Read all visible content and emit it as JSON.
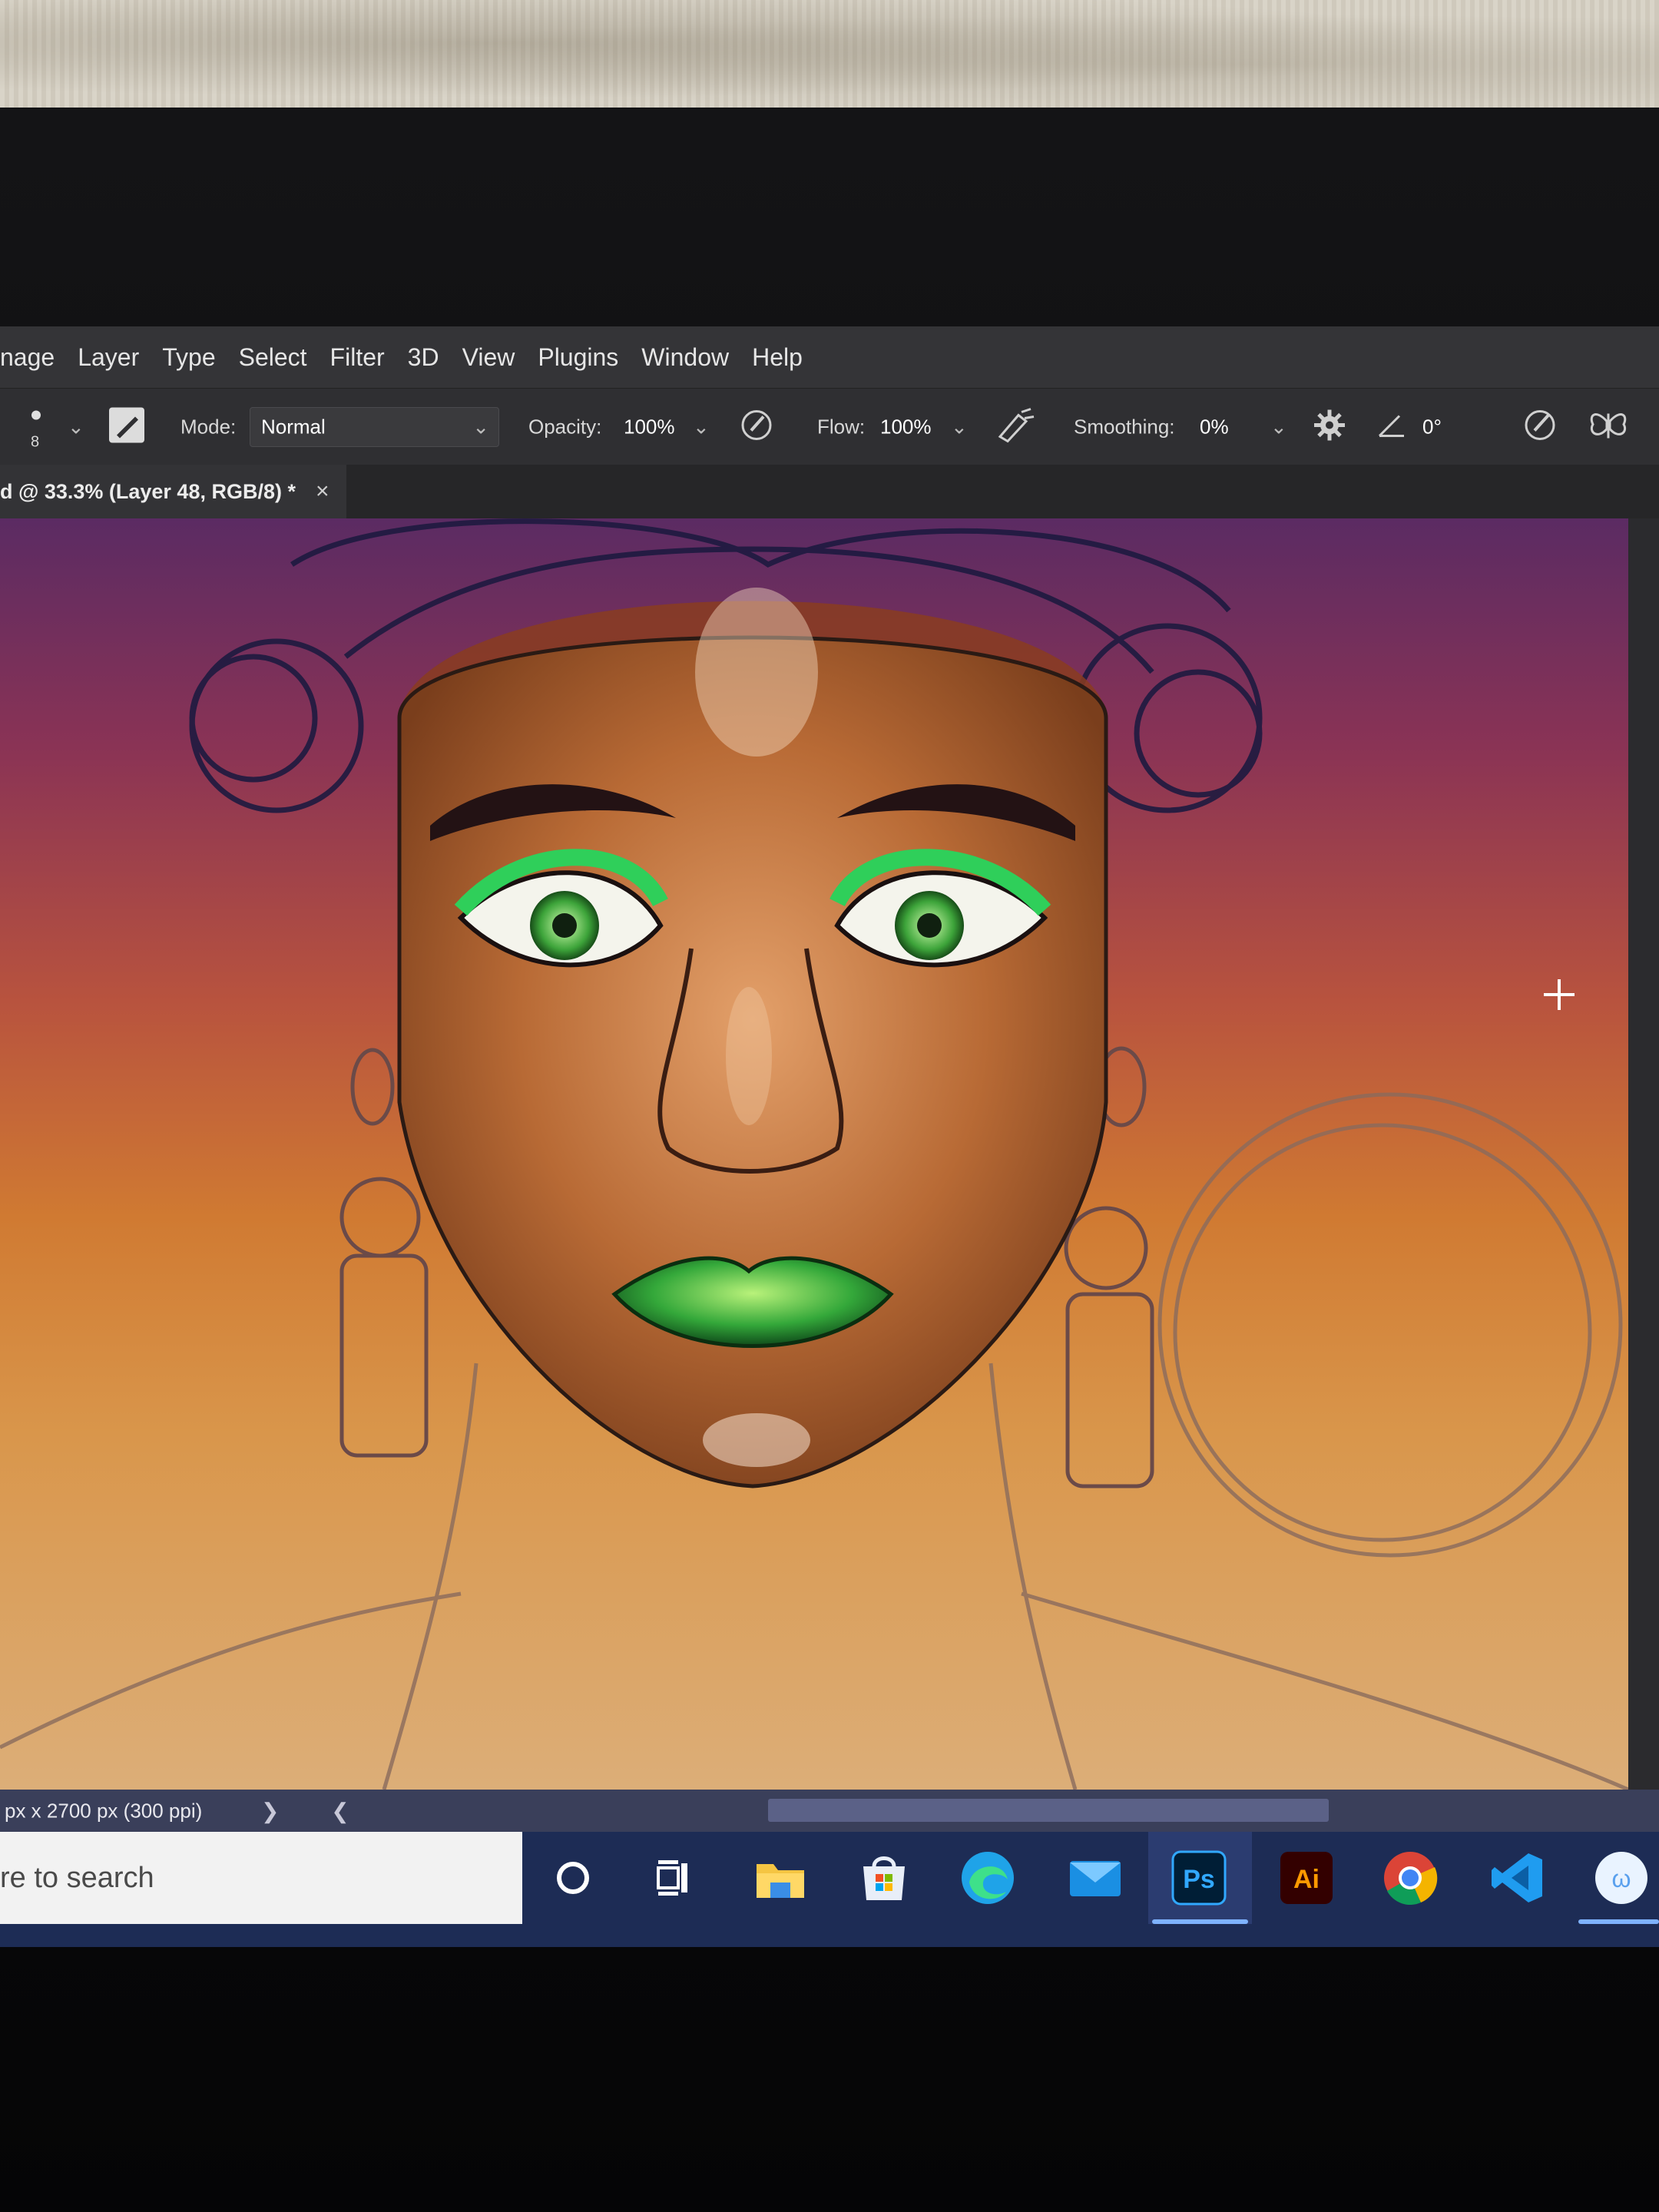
{
  "menu": [
    "nage",
    "Layer",
    "Type",
    "Select",
    "Filter",
    "3D",
    "View",
    "Plugins",
    "Window",
    "Help"
  ],
  "options_bar": {
    "brush_size": "8",
    "mode_label": "Mode:",
    "mode_value": "Normal",
    "opacity_label": "Opacity:",
    "opacity_value": "100%",
    "flow_label": "Flow:",
    "flow_value": "100%",
    "smoothing_label": "Smoothing:",
    "smoothing_value": "0%",
    "angle_value": "0°"
  },
  "document_tab": {
    "title": "d @ 33.3% (Layer 48, RGB/8) *",
    "close": "×"
  },
  "status_bar": {
    "doc_info": "px x 2700 px (300 ppi)",
    "nav": "❯ ❮"
  },
  "taskbar": {
    "search_placeholder": "re to search",
    "apps": [
      "cortana-icon",
      "task-view-icon",
      "file-explorer-icon",
      "microsoft-store-icon",
      "edge-icon",
      "mail-icon",
      "photoshop-icon",
      "illustrator-icon",
      "chrome-icon",
      "vscode-icon",
      "app-icon"
    ],
    "ps_label": "Ps",
    "ai_label": "Ai"
  },
  "colors": {
    "accent": "#31a8ff",
    "ps_blue": "#001e36",
    "ai_orange": "#ff9a00"
  }
}
